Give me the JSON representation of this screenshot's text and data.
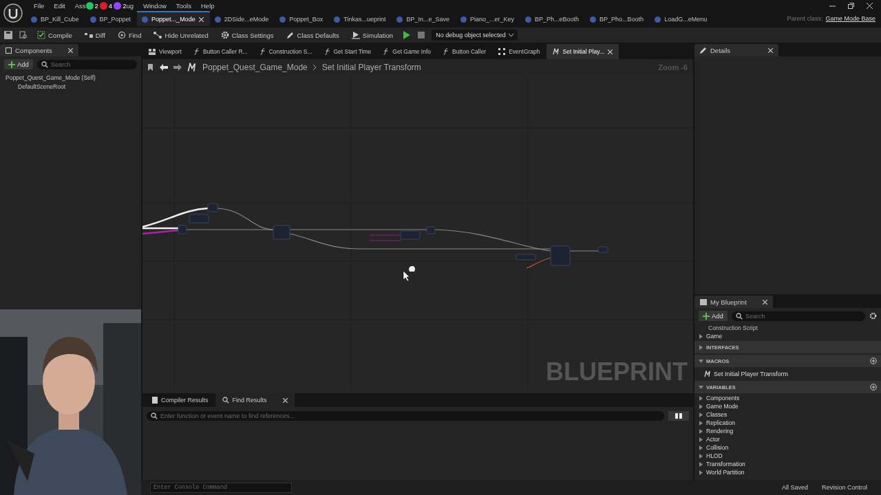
{
  "menu": [
    "File",
    "Edit",
    "Ass",
    "ug",
    "Window",
    "Tools",
    "Help"
  ],
  "stream_badges": [
    {
      "count": "2",
      "color": "#22c55e"
    },
    {
      "count": "4",
      "color": "#e11d2a"
    },
    {
      "count": "2",
      "color": "#9146ff"
    }
  ],
  "document_tabs": [
    {
      "label": "BP_Kill_Cube",
      "selected": false
    },
    {
      "label": "BP_Poppet",
      "selected": false
    },
    {
      "label": "Poppet..._Mode",
      "selected": true
    },
    {
      "label": "2DSide...eMode",
      "selected": false
    },
    {
      "label": "Poppet_Box",
      "selected": false
    },
    {
      "label": "Tinkas...ueprint",
      "selected": false
    },
    {
      "label": "BP_In...e_Save",
      "selected": false
    },
    {
      "label": "Piano_...er_Key",
      "selected": false
    },
    {
      "label": "BP_Ph...eBooth",
      "selected": false
    },
    {
      "label": "BP_Pho...Booth",
      "selected": false
    },
    {
      "label": "LoadG...eMenu",
      "selected": false
    }
  ],
  "parent_class": {
    "label": "Parent class:",
    "value": "Game Mode Base"
  },
  "toolbar": [
    {
      "kind": "compile",
      "label": "Compile"
    },
    {
      "kind": "diff",
      "label": "Diff"
    },
    {
      "kind": "find",
      "label": "Find"
    },
    {
      "kind": "hide",
      "label": "Hide Unrelated"
    },
    {
      "kind": "settings",
      "label": "Class Settings"
    },
    {
      "kind": "defaults",
      "label": "Class Defaults"
    },
    {
      "kind": "simulation",
      "label": "Simulation"
    }
  ],
  "debug_dropdown": "No debug object selected",
  "components": {
    "title": "Components",
    "add": "Add",
    "placeholder": "Search",
    "tree": [
      {
        "label": "Poppet_Quest_Game_Mode (Self)",
        "children": [
          {
            "label": "DefaultSceneRoot"
          }
        ]
      }
    ]
  },
  "graph_tabs": [
    {
      "kind": "viewport",
      "label": "Viewport",
      "selected": false
    },
    {
      "kind": "function",
      "label": "Button Caller R...",
      "selected": false
    },
    {
      "kind": "function",
      "label": "Construction S...",
      "selected": false
    },
    {
      "kind": "function",
      "label": "Get Start Time",
      "selected": false
    },
    {
      "kind": "function",
      "label": "Get Game Info",
      "selected": false
    },
    {
      "kind": "function",
      "label": "Button Caller",
      "selected": false
    },
    {
      "kind": "graph",
      "label": "EventGraph",
      "selected": false
    },
    {
      "kind": "macro",
      "label": "Set Initial Play...",
      "selected": true
    }
  ],
  "breadcrumb": [
    "Poppet_Quest_Game_Mode",
    "Set Initial Player Transform"
  ],
  "zoom": "Zoom -6",
  "watermark": "BLUEPRINT",
  "bottom_tabs": [
    {
      "label": "Compiler Results",
      "selected": false
    },
    {
      "label": "Find Results",
      "selected": true
    }
  ],
  "find_placeholder": "Enter function or event name to find references...",
  "console_placeholder": "Enter Console Command",
  "details": {
    "title": "Details"
  },
  "my_blueprint": {
    "title": "My Blueprint",
    "add": "Add",
    "placeholder": "Search",
    "items": [
      {
        "kind": "item",
        "label": "Construction Script"
      },
      {
        "kind": "category",
        "label": "Game"
      },
      {
        "kind": "section",
        "label": "INTERFACES",
        "expanded": false,
        "addable": false
      },
      {
        "kind": "section",
        "label": "MACROS",
        "expanded": true,
        "addable": true
      },
      {
        "kind": "macro",
        "label": "Set Initial Player Transform"
      },
      {
        "kind": "section",
        "label": "VARIABLES",
        "expanded": true,
        "addable": true
      },
      {
        "kind": "category",
        "label": "Components"
      },
      {
        "kind": "category",
        "label": "Game Mode"
      },
      {
        "kind": "category",
        "label": "Classes"
      },
      {
        "kind": "category",
        "label": "Replication"
      },
      {
        "kind": "category",
        "label": "Rendering"
      },
      {
        "kind": "category",
        "label": "Actor"
      },
      {
        "kind": "category",
        "label": "Collision"
      },
      {
        "kind": "category",
        "label": "HLOD"
      },
      {
        "kind": "category",
        "label": "Transformation"
      },
      {
        "kind": "category",
        "label": "World Partition"
      }
    ]
  },
  "status": [
    "All Saved",
    "Revision Control"
  ]
}
